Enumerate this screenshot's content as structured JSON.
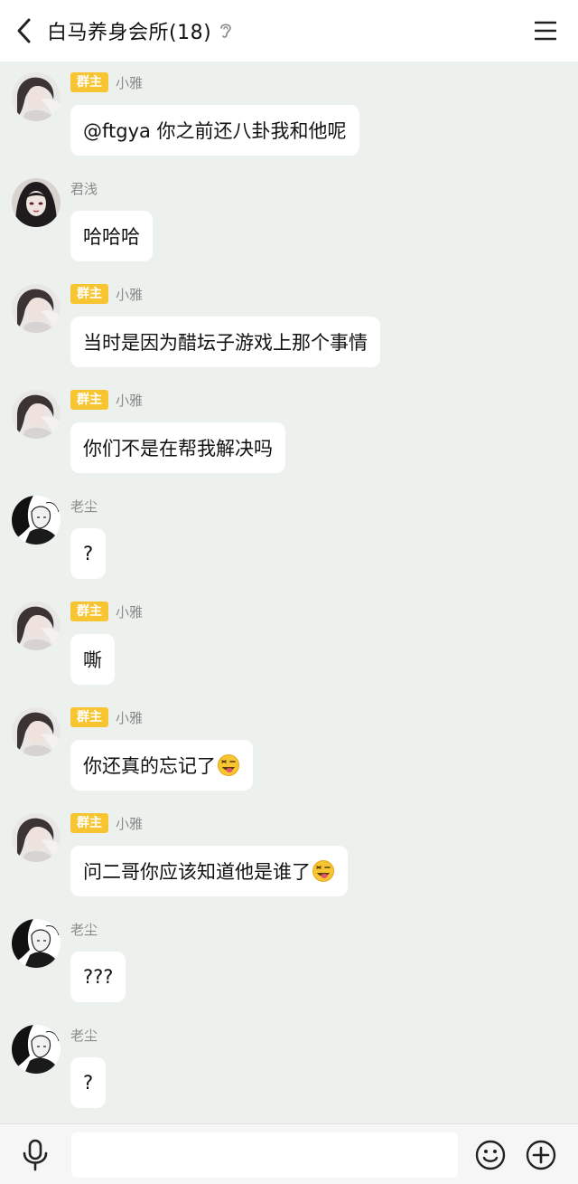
{
  "header": {
    "title": "白马养身会所(18)"
  },
  "messages": [
    {
      "name": "小雅",
      "badge": "群主",
      "text": "@ftgya 你之前还八卦我和他呢",
      "avatar": "girl-avatar",
      "emoji": false
    },
    {
      "name": "君浅",
      "badge": "",
      "text": "哈哈哈",
      "avatar": "anime-avatar",
      "emoji": false
    },
    {
      "name": "小雅",
      "badge": "群主",
      "text": "当时是因为醋坛子游戏上那个事情",
      "avatar": "girl-avatar",
      "emoji": false
    },
    {
      "name": "小雅",
      "badge": "群主",
      "text": "你们不是在帮我解决吗",
      "avatar": "girl-avatar",
      "emoji": false
    },
    {
      "name": "老尘",
      "badge": "",
      "text": "?",
      "avatar": "sketch-avatar",
      "emoji": false
    },
    {
      "name": "小雅",
      "badge": "群主",
      "text": "嘶",
      "avatar": "girl-avatar",
      "emoji": false
    },
    {
      "name": "小雅",
      "badge": "群主",
      "text": "你还真的忘记了",
      "avatar": "girl-avatar",
      "emoji": true
    },
    {
      "name": "小雅",
      "badge": "群主",
      "text": "问二哥你应该知道他是谁了",
      "avatar": "girl-avatar",
      "emoji": true
    },
    {
      "name": "老尘",
      "badge": "",
      "text": "???",
      "avatar": "sketch-avatar",
      "emoji": false
    },
    {
      "name": "老尘",
      "badge": "",
      "text": "?",
      "avatar": "sketch-avatar",
      "emoji": false
    }
  ],
  "input": {
    "value": "",
    "placeholder": ""
  },
  "colors": {
    "chat_bg": "#edf1ed",
    "badge": "#f7c531",
    "bubble": "#ffffff"
  },
  "icons": {
    "back": "chevron-left-icon",
    "ear": "ear-icon",
    "menu": "menu-icon",
    "mic": "microphone-icon",
    "emoji": "smiley-icon",
    "plus": "plus-circle-icon",
    "message_emoji": "tongue-wink-emoji"
  }
}
